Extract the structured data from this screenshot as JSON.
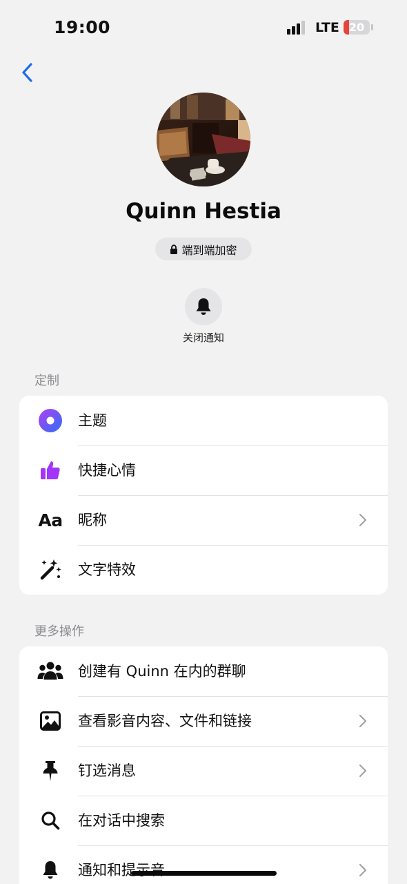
{
  "status_bar": {
    "time": "19:00",
    "network": "LTE",
    "battery": "20",
    "battery_level_percent": 20
  },
  "nav": {
    "back_icon": "chevron-left-icon"
  },
  "profile": {
    "name": "Quinn Hestia",
    "encryption_label": "端到端加密",
    "mute_label": "关闭通知"
  },
  "customize": {
    "title": "定制",
    "items": [
      {
        "label": "主题",
        "icon": "theme-circle-icon",
        "has_chevron": false
      },
      {
        "label": "快捷心情",
        "icon": "thumbs-up-icon",
        "has_chevron": false
      },
      {
        "label": "昵称",
        "icon": "font-aa-icon",
        "icon_text": "Aa",
        "has_chevron": true
      },
      {
        "label": "文字特效",
        "icon": "magic-wand-icon",
        "has_chevron": false
      }
    ]
  },
  "more_actions": {
    "title": "更多操作",
    "items": [
      {
        "label": "创建有 Quinn 在内的群聊",
        "icon": "group-icon",
        "has_chevron": false
      },
      {
        "label": "查看影音内容、文件和链接",
        "icon": "image-icon",
        "has_chevron": true
      },
      {
        "label": "钉选消息",
        "icon": "pin-icon",
        "has_chevron": true
      },
      {
        "label": "在对话中搜索",
        "icon": "search-icon",
        "has_chevron": false
      },
      {
        "label": "通知和提示音",
        "icon": "bell-icon",
        "has_chevron": true
      }
    ]
  },
  "colors": {
    "theme_gradient_start": "#b23ef2",
    "theme_gradient_end": "#2f6ff5",
    "accent_purple": "#a334fa",
    "back_blue": "#1c6ee8",
    "battery_red": "#e5443b"
  }
}
